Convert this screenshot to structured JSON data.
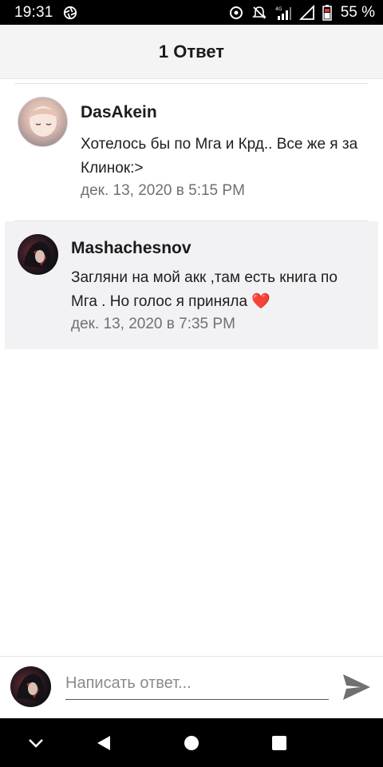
{
  "status_bar": {
    "time": "19:31",
    "left_icon": "aperture-icon",
    "right_icons": [
      "sync-icon",
      "mute-icon",
      "signal-4g-icon",
      "wifi-off-icon",
      "battery-icon"
    ],
    "battery_text": "55 %"
  },
  "header": {
    "title": "1 Ответ"
  },
  "comments": [
    {
      "author": "DasAkein",
      "text": "Хотелось бы по Мга и Крд.. Все же я за Клинок:>",
      "date": "дек. 13, 2020 в 5:15 PM"
    },
    {
      "author": "Mashachesnov",
      "text": "Загляни на мой акк ,там есть книга по Мга . Но голос я приняла",
      "heart": "❤️",
      "date": "дек. 13, 2020 в 7:35 PM"
    }
  ],
  "reply": {
    "placeholder": "Написать ответ...",
    "value": ""
  },
  "nav": {
    "items": [
      "chevron-down-icon",
      "back-icon",
      "home-icon",
      "recents-icon"
    ]
  },
  "colors": {
    "status_bar": "#000000",
    "header_bg": "#f5f4f5",
    "highlight_bg": "#f2f1f4",
    "date_text": "#707070",
    "send_icon": "#707070"
  }
}
